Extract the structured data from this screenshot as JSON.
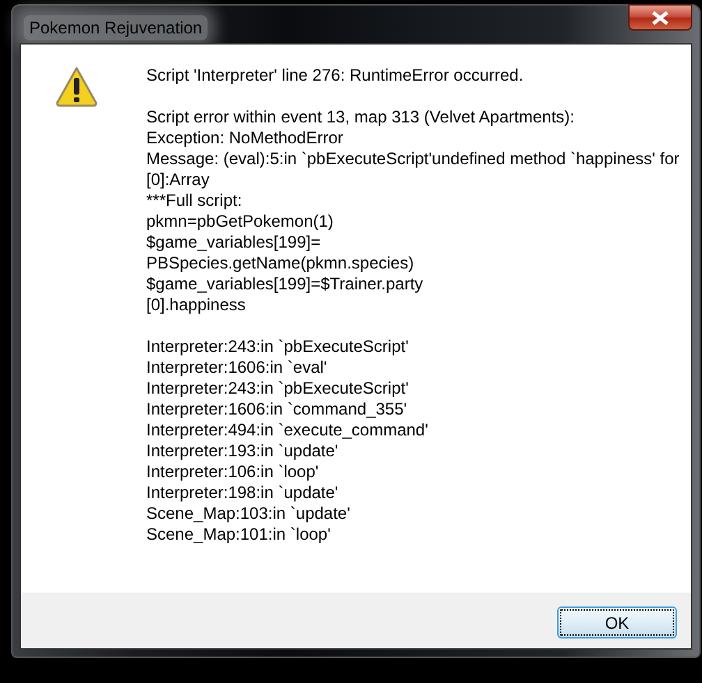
{
  "window": {
    "title": "Pokemon Rejuvenation"
  },
  "message": {
    "paragraphs": [
      [
        "Script 'Interpreter' line 276: RuntimeError occurred."
      ],
      [
        "Script error within event 13, map 313 (Velvet Apartments):",
        "Exception: NoMethodError",
        "Message: (eval):5:in `pbExecuteScript'undefined method `happiness' for",
        "[0]:Array",
        "***Full script:",
        "pkmn=pbGetPokemon(1)",
        "$game_variables[199]=",
        "PBSpecies.getName(pkmn.species)",
        "$game_variables[199]=$Trainer.party",
        "[0].happiness"
      ],
      [
        "Interpreter:243:in `pbExecuteScript'",
        "Interpreter:1606:in `eval'",
        "Interpreter:243:in `pbExecuteScript'",
        "Interpreter:1606:in `command_355'",
        "Interpreter:494:in `execute_command'",
        "Interpreter:193:in `update'",
        "Interpreter:106:in `loop'",
        "Interpreter:198:in `update'",
        "Scene_Map:103:in `update'",
        "Scene_Map:101:in `loop'"
      ]
    ]
  },
  "buttons": [
    {
      "label": "OK",
      "focused": true
    }
  ]
}
